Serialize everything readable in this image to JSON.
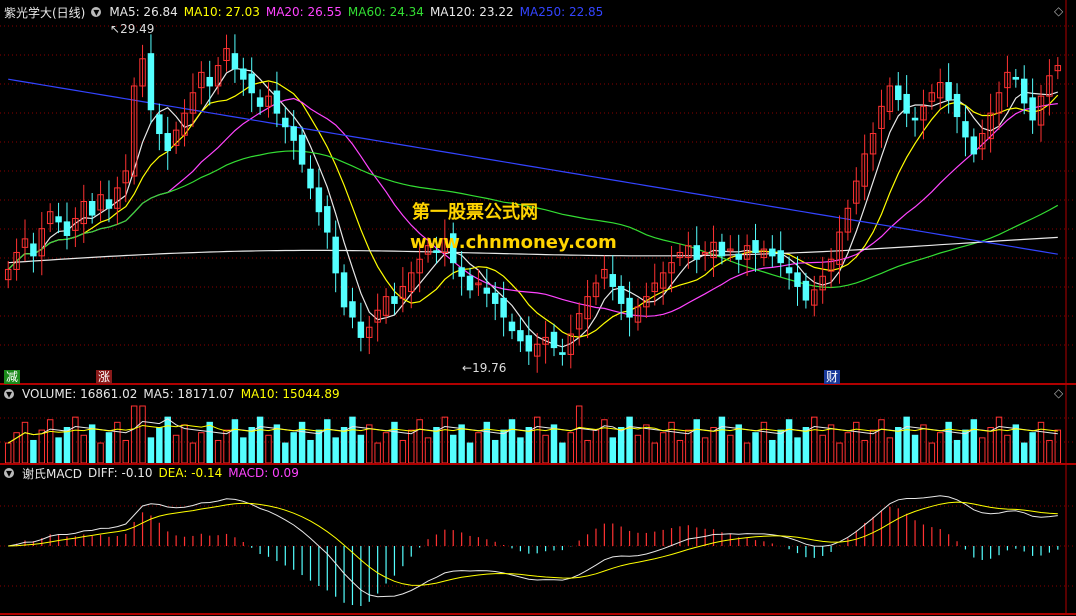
{
  "price_panel": {
    "title": "紫光学大(日线)",
    "indicators": [
      {
        "label": "MA5: 26.84",
        "color": "#e8e8e8"
      },
      {
        "label": "MA10: 27.03",
        "color": "#ffff00"
      },
      {
        "label": "MA20: 26.55",
        "color": "#ff44ff"
      },
      {
        "label": "MA60: 24.34",
        "color": "#33dd33"
      },
      {
        "label": "MA120: 23.22",
        "color": "#e8e8e8"
      },
      {
        "label": "MA250: 22.85",
        "color": "#3344ff"
      }
    ],
    "high_label": "29.49",
    "low_label": "19.76",
    "tags": [
      {
        "text": "减",
        "color": "#ffffff",
        "bg": "#1a8a1a"
      },
      {
        "text": "涨",
        "color": "#ffffff",
        "bg": "#8a1a1a"
      },
      {
        "text": "财",
        "color": "#ffffff",
        "bg": "#1a3a9a"
      }
    ],
    "watermark_line1": "第一股票公式网",
    "watermark_line2": "www.chnmoney.com"
  },
  "volume_panel": {
    "title": "VOLUME: 16861.02",
    "indicators": [
      {
        "label": "MA5: 18171.07",
        "color": "#e8e8e8"
      },
      {
        "label": "MA10: 15044.89",
        "color": "#ffff00"
      }
    ]
  },
  "macd_panel": {
    "title": "谢氏MACD",
    "indicators": [
      {
        "label": "DIFF: -0.10",
        "color": "#e8e8e8"
      },
      {
        "label": "DEA: -0.14",
        "color": "#ffff00"
      },
      {
        "label": "MACD: 0.09",
        "color": "#ff44ff"
      }
    ]
  },
  "colors": {
    "up": "#ff3232",
    "down": "#54ffff",
    "grid": "#8a0000",
    "border": "#b00000"
  },
  "chart_data": {
    "type": "candlestick",
    "title": "紫光学大(日线)",
    "price_range": [
      19.5,
      29.8
    ],
    "high": 29.49,
    "low": 19.76,
    "closes": [
      22.4,
      22.9,
      23.3,
      22.8,
      23.6,
      24.1,
      23.8,
      23.4,
      23.9,
      24.4,
      24.0,
      24.6,
      24.2,
      24.8,
      25.3,
      27.8,
      28.6,
      27.1,
      26.4,
      25.9,
      26.5,
      27.0,
      27.6,
      28.2,
      27.8,
      28.4,
      28.9,
      28.3,
      28.0,
      27.6,
      27.2,
      27.5,
      27.0,
      26.6,
      26.2,
      25.5,
      24.8,
      24.1,
      23.5,
      22.3,
      21.3,
      21.0,
      20.4,
      20.7,
      21.2,
      21.6,
      21.4,
      21.9,
      22.3,
      22.7,
      23.1,
      22.9,
      23.3,
      22.6,
      22.2,
      21.8,
      22.0,
      21.7,
      21.4,
      21.0,
      20.6,
      20.3,
      20.0,
      20.2,
      20.4,
      20.1,
      19.9,
      20.5,
      21.1,
      21.6,
      22.0,
      22.4,
      21.9,
      21.4,
      21.0,
      21.3,
      21.6,
      22.0,
      22.3,
      22.6,
      22.9,
      23.1,
      22.7,
      22.9,
      23.2,
      22.8,
      23.0,
      22.7,
      23.1,
      22.9,
      23.0,
      22.8,
      22.6,
      22.3,
      21.9,
      21.5,
      21.8,
      22.2,
      22.7,
      23.5,
      24.2,
      25.0,
      25.8,
      26.4,
      27.2,
      27.8,
      27.4,
      27.0,
      26.8,
      27.2,
      27.6,
      27.9,
      27.4,
      26.9,
      26.3,
      25.8,
      26.4,
      27.0,
      27.6,
      28.2,
      28.0,
      27.3,
      26.8,
      27.5,
      28.1,
      28.4
    ],
    "ma": [
      {
        "name": "MA5",
        "last": 26.84
      },
      {
        "name": "MA10",
        "last": 27.03
      },
      {
        "name": "MA20",
        "last": 26.55
      },
      {
        "name": "MA60",
        "last": 24.34
      },
      {
        "name": "MA120",
        "last": 23.22
      },
      {
        "name": "MA250",
        "last": 22.85
      }
    ],
    "volume": {
      "last": 16861.02,
      "ma5": 18171.07,
      "ma10": 15044.89
    },
    "macd": {
      "diff": -0.1,
      "dea": -0.14,
      "macd": 0.09
    }
  }
}
